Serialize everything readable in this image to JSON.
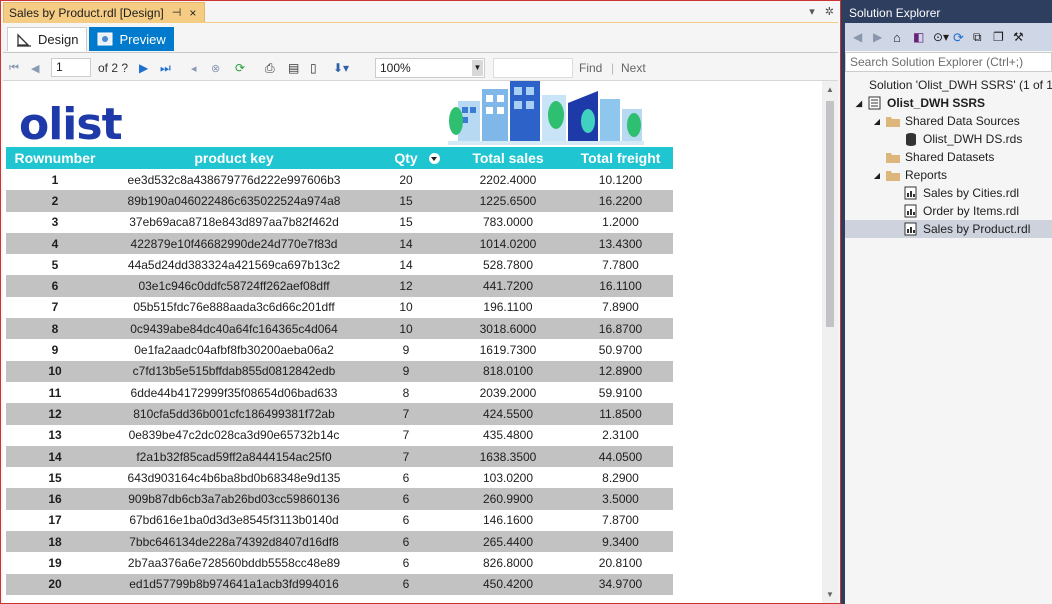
{
  "document": {
    "tab_title": "Sales by Product.rdl [Design]",
    "pin_glyph": "⊣",
    "close_glyph": "×",
    "design_tab": "Design",
    "preview_tab": "Preview"
  },
  "report_toolbar": {
    "page_current": "1",
    "page_of": "of  2 ?",
    "zoom": "100%",
    "find": "Find",
    "next": "Next"
  },
  "report": {
    "logo_text": "olist",
    "columns": [
      "Rownumber",
      "product key",
      "Qty",
      "Total sales",
      "Total freight"
    ],
    "rows": [
      [
        "1",
        "ee3d532c8a438679776d222e997606b3",
        "20",
        "2202.4000",
        "10.1200"
      ],
      [
        "2",
        "89b190a046022486c635022524a974a8",
        "15",
        "1225.6500",
        "16.2200"
      ],
      [
        "3",
        "37eb69aca8718e843d897aa7b82f462d",
        "15",
        "783.0000",
        "1.2000"
      ],
      [
        "4",
        "422879e10f46682990de24d770e7f83d",
        "14",
        "1014.0200",
        "13.4300"
      ],
      [
        "5",
        "44a5d24dd383324a421569ca697b13c2",
        "14",
        "528.7800",
        "7.7800"
      ],
      [
        "6",
        "03e1c946c0ddfc58724ff262aef08dff",
        "12",
        "441.7200",
        "16.1100"
      ],
      [
        "7",
        "05b515fdc76e888aada3c6d66c201dff",
        "10",
        "196.1100",
        "7.8900"
      ],
      [
        "8",
        "0c9439abe84dc40a64fc164365c4d064",
        "10",
        "3018.6000",
        "16.8700"
      ],
      [
        "9",
        "0e1fa2aadc04afbf8fb30200aeba06a2",
        "9",
        "1619.7300",
        "50.9700"
      ],
      [
        "10",
        "c7fd13b5e515bffdab855d0812842edb",
        "9",
        "818.0100",
        "12.8900"
      ],
      [
        "11",
        "6dde44b4172999f35f08654d06bad633",
        "8",
        "2039.2000",
        "59.9100"
      ],
      [
        "12",
        "810cfa5dd36b001cfc186499381f72ab",
        "7",
        "424.5500",
        "11.8500"
      ],
      [
        "13",
        "0e839be47c2dc028ca3d90e65732b14c",
        "7",
        "435.4800",
        "2.3100"
      ],
      [
        "14",
        "f2a1b32f85cad59ff2a8444154ac25f0",
        "7",
        "1638.3500",
        "44.0500"
      ],
      [
        "15",
        "643d903164c4b6ba8bd0b68348e9d135",
        "6",
        "103.0200",
        "8.2900"
      ],
      [
        "16",
        "909b87db6cb3a7ab26bd03cc59860136",
        "6",
        "260.9900",
        "3.5000"
      ],
      [
        "17",
        "67bd616e1ba0d3d3e8545f3113b0140d",
        "6",
        "146.1600",
        "7.8700"
      ],
      [
        "18",
        "7bbc646134de228a74392d8407d16df8",
        "6",
        "265.4400",
        "9.3400"
      ],
      [
        "19",
        "2b7aa376a6e728560bddb5558cc48e89",
        "6",
        "826.8000",
        "20.8100"
      ],
      [
        "20",
        "ed1d57799b8b974641a1acb3fd994016",
        "6",
        "450.4200",
        "34.9700"
      ]
    ]
  },
  "solution_explorer": {
    "title": "Solution Explorer",
    "search_placeholder": "Search Solution Explorer (Ctrl+;)",
    "tree": {
      "solution": "Solution 'Olist_DWH SSRS' (1 of 1",
      "project": "Olist_DWH SSRS",
      "shared_data_sources": "Shared Data Sources",
      "data_source": "Olist_DWH DS.rds",
      "shared_datasets": "Shared Datasets",
      "reports": "Reports",
      "report_items": [
        "Sales by Cities.rdl",
        "Order by Items.rdl",
        "Sales by Product.rdl"
      ]
    }
  },
  "colors": {
    "header_teal": "#1fc5d1",
    "logo_blue": "#1e3aa8",
    "alt_row": "#c2c2c2",
    "vs_accent": "#007acc",
    "tab_gold": "#f5cc84"
  }
}
